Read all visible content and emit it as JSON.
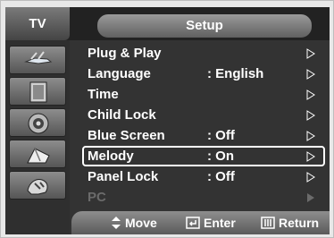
{
  "header": {
    "source_label": "TV",
    "title": "Setup"
  },
  "sidebar": {
    "icons": [
      "antenna-icon",
      "picture-icon",
      "speaker-icon",
      "channel-icon",
      "setup-icon"
    ]
  },
  "menu": {
    "items": [
      {
        "label": "Plug & Play",
        "value": ""
      },
      {
        "label": "Language",
        "value": ": English"
      },
      {
        "label": "Time",
        "value": ""
      },
      {
        "label": "Child Lock",
        "value": ""
      },
      {
        "label": "Blue Screen",
        "value": ": Off"
      },
      {
        "label": "Melody",
        "value": ": On"
      },
      {
        "label": "Panel Lock",
        "value": ": Off"
      },
      {
        "label": "PC",
        "value": ""
      }
    ],
    "selected_index": 5
  },
  "footer": {
    "move_label": "Move",
    "enter_label": "Enter",
    "return_label": "Return"
  },
  "colors": {
    "panel": "#333333",
    "text": "#ffffff",
    "disabled": "#6b6b6b"
  }
}
